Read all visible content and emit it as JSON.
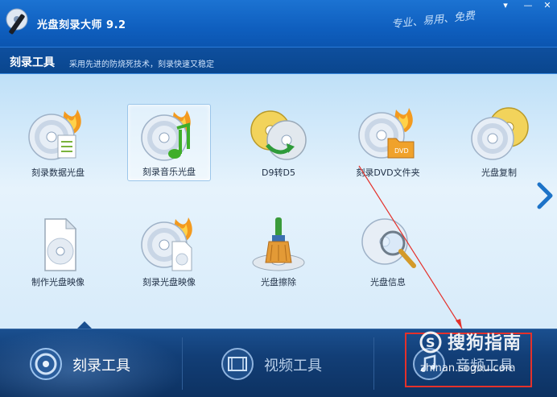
{
  "app": {
    "title": "光盘刻录大师 9.2",
    "slogan": "专业、易用、免费",
    "window_controls": [
      "▾",
      "—",
      "✕"
    ]
  },
  "section": {
    "title": "刻录工具",
    "description": "采用先进的防烧死技术，刻录快速又稳定"
  },
  "tools": [
    {
      "label": "刻录数据光盘",
      "icon": "burn-data-disc-icon"
    },
    {
      "label": "刻录音乐光盘",
      "icon": "burn-music-disc-icon",
      "selected": true
    },
    {
      "label": "D9转D5",
      "icon": "d9-to-d5-icon"
    },
    {
      "label": "刻录DVD文件夹",
      "icon": "burn-dvd-folder-icon"
    },
    {
      "label": "光盘复制",
      "icon": "disc-copy-icon"
    },
    {
      "label": "制作光盘映像",
      "icon": "make-disc-image-icon"
    },
    {
      "label": "刻录光盘映像",
      "icon": "burn-disc-image-icon"
    },
    {
      "label": "光盘擦除",
      "icon": "disc-erase-icon"
    },
    {
      "label": "光盘信息",
      "icon": "disc-info-icon"
    }
  ],
  "bottom_tabs": [
    {
      "label": "刻录工具",
      "icon": "disc-icon",
      "active": true
    },
    {
      "label": "视频工具",
      "icon": "film-icon",
      "active": false
    },
    {
      "label": "音频工具",
      "icon": "audio-icon",
      "active": false
    }
  ],
  "watermark": {
    "brand": "搜狗指南",
    "url": "zhinan.sogou.com"
  },
  "colors": {
    "title_bar": "#0f5fbf",
    "content_bg": "#d7ebfa",
    "bottom_bar": "#123e76",
    "annotation": "#e4312b"
  }
}
